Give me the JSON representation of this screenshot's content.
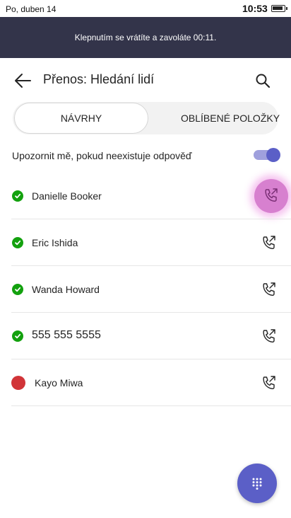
{
  "status_bar": {
    "date": "Po, duben 14",
    "time": "10:53"
  },
  "banner": {
    "text": "Klepnutím se vrátíte a zavoláte 00:11."
  },
  "header": {
    "title": "Přenos: Hledání lidí",
    "back_icon": "arrow-left-icon",
    "search_icon": "search-icon"
  },
  "tabs": [
    {
      "label": "NÁVRHY",
      "selected": true
    },
    {
      "label": "OBLÍBENÉ POLOŽKY",
      "selected": false
    }
  ],
  "notify": {
    "label": "Upozornit mě, pokud neexistuje odpověď",
    "enabled": true
  },
  "contacts": [
    {
      "name": "Danielle Booker",
      "presence": "available",
      "call_active": true
    },
    {
      "name": "Eric Ishida",
      "presence": "available",
      "call_active": false
    },
    {
      "name": "Wanda Howard",
      "presence": "available",
      "call_active": false
    },
    {
      "name": "555 555 5555",
      "presence": "available",
      "call_active": false
    },
    {
      "name": "Kayo Miwa",
      "presence": "busy",
      "call_active": false
    }
  ],
  "colors": {
    "banner": "#33344a",
    "accent": "#5b5fc7",
    "available": "#13a10e",
    "busy": "#d13438",
    "highlight": "#d780cf"
  },
  "fab": {
    "icon": "dialpad-icon"
  }
}
